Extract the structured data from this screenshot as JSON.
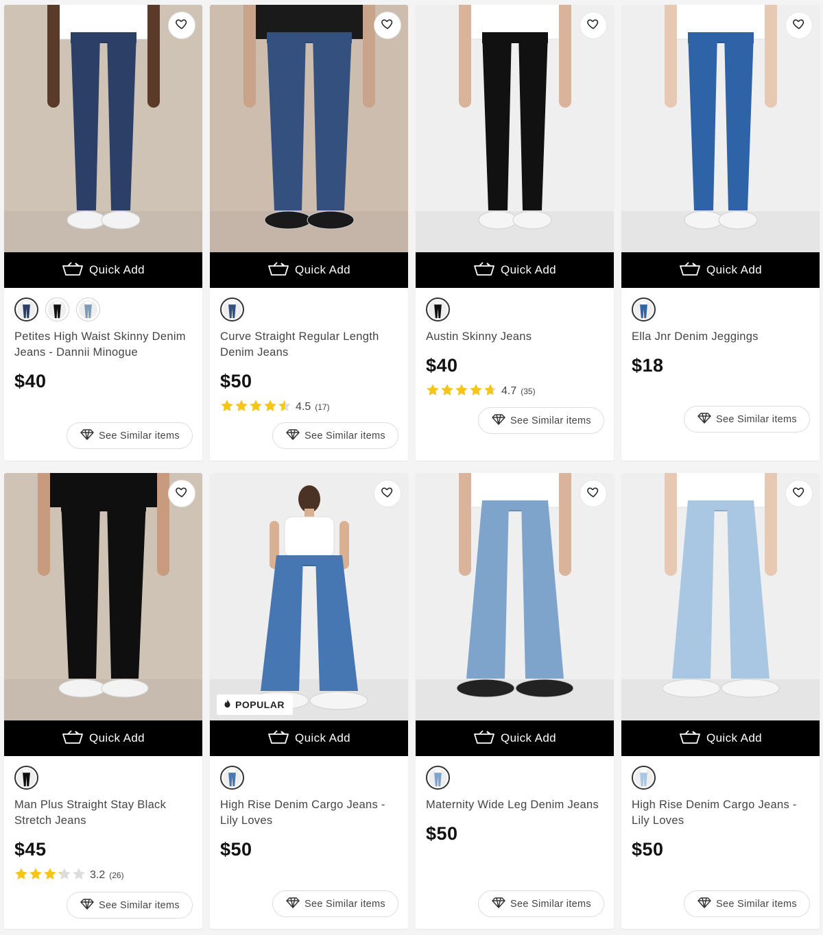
{
  "quick_add_label": "Quick Add",
  "see_similar_label": "See Similar items",
  "popular_label": "POPULAR",
  "products": [
    {
      "name": "Petites High Waist Skinny Denim Jeans - Dannii Minogue",
      "price": "$40",
      "rating": null,
      "reviews": null,
      "popular": false,
      "bg": "#cfc3b6",
      "jeans": "#2c3f66",
      "top": "#ffffff",
      "shoes": "#f3f3f3",
      "skin": "#5a3a28",
      "swatches": [
        "#2c3f66",
        "#111111",
        "#7f99b6"
      ]
    },
    {
      "name": "Curve Straight Regular Length Denim Jeans",
      "price": "$50",
      "rating": 4.5,
      "rating_label": "4.5",
      "reviews": "(17)",
      "popular": false,
      "bg": "#cdbdaf",
      "jeans": "#33507e",
      "top": "#1a1a1a",
      "shoes": "#1a1a1a",
      "skin": "#c9a48a",
      "swatches": [
        "#33507e"
      ]
    },
    {
      "name": "Austin Skinny Jeans",
      "price": "$40",
      "rating": 4.7,
      "rating_label": "4.7",
      "reviews": "(35)",
      "popular": false,
      "bg": "#efefef",
      "jeans": "#111111",
      "top": "#ffffff",
      "shoes": "#f5f5f5",
      "skin": "#d9b49a",
      "swatches": [
        "#111111"
      ]
    },
    {
      "name": "Ella Jnr Denim Jeggings",
      "price": "$18",
      "rating": null,
      "reviews": null,
      "popular": false,
      "bg": "#efefef",
      "jeans": "#2f63a7",
      "top": "#ffffff",
      "shoes": "#f5f5f5",
      "skin": "#e6c8b3",
      "swatches": [
        "#2f63a7"
      ]
    },
    {
      "name": "Man Plus Straight Stay Black Stretch Jeans",
      "price": "$45",
      "rating": 3.2,
      "rating_label": "3.2",
      "reviews": "(26)",
      "popular": false,
      "bg": "#cfc3b6",
      "jeans": "#0f0f0f",
      "top": "#0f0f0f",
      "shoes": "#f3f3f3",
      "skin": "#c99b7e",
      "swatches": [
        "#0f0f0f"
      ]
    },
    {
      "name": "High Rise Denim Cargo Jeans - Lily Loves",
      "price": "$50",
      "rating": null,
      "reviews": null,
      "popular": true,
      "bg": "#eeeeee",
      "jeans": "#4677b3",
      "top": "#ffffff",
      "shoes": "#f5f5f5",
      "skin": "#d9b092",
      "swatches": [
        "#4677b3"
      ]
    },
    {
      "name": "Maternity Wide Leg Denim Jeans",
      "price": "$50",
      "rating": null,
      "reviews": null,
      "popular": false,
      "bg": "#efefef",
      "jeans": "#7fa4cc",
      "top": "#ffffff",
      "shoes": "#222222",
      "skin": "#d9b49a",
      "swatches": [
        "#7fa4cc"
      ]
    },
    {
      "name": "High Rise Denim Cargo Jeans - Lily Loves",
      "price": "$50",
      "rating": null,
      "reviews": null,
      "popular": false,
      "bg": "#efefef",
      "jeans": "#a9c7e2",
      "top": "#ffffff",
      "shoes": "#f5f5f5",
      "skin": "#e6c8b3",
      "swatches": [
        "#a9c7e2"
      ]
    }
  ],
  "colors": {
    "star_filled": "#f5c518",
    "star_empty": "#dddddd",
    "quick_add_bg": "#000000"
  },
  "icons": {
    "wishlist": "heart-outline-icon",
    "quick_add": "basket-icon",
    "similar": "diamond-icon",
    "popular": "flame-icon",
    "rating": "star-icon"
  }
}
